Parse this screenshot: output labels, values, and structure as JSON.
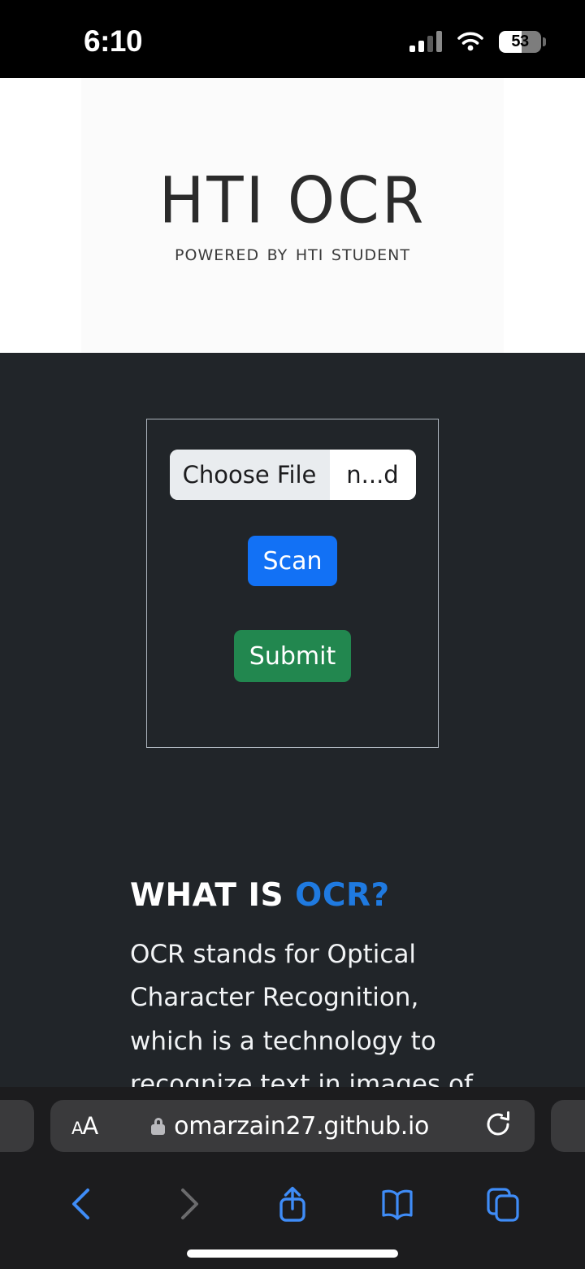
{
  "status_bar": {
    "time": "6:10",
    "signal_icon": "cellular-signal-icon",
    "wifi_icon": "wifi-icon",
    "battery_percent": "53",
    "battery_level": 53
  },
  "site_header": {
    "logo_title": "HTI OCR",
    "logo_subtitle": "Powered by HTI Student"
  },
  "upload_card": {
    "file_input": {
      "button_label": "Choose File",
      "file_name": "n...d"
    },
    "scan_label": "Scan",
    "submit_label": "Submit"
  },
  "about": {
    "heading_prefix": "WHAT IS ",
    "heading_accent": "OCR?",
    "body": "OCR stands for Optical Character Recognition, which is a technology to recognize text in images of scanned"
  },
  "browser": {
    "text_size_small": "A",
    "text_size_big": "A",
    "lock_icon": "lock-icon",
    "url": "omarzain27.github.io",
    "reload_icon": "reload-icon",
    "back_icon": "chevron-left-icon",
    "forward_icon": "chevron-right-icon",
    "share_icon": "share-icon",
    "bookmarks_icon": "book-icon",
    "tabs_icon": "tabs-icon"
  },
  "colors": {
    "page_background": "#212529",
    "header_background": "#ffffff",
    "scan_blue": "#1271f5",
    "submit_green": "#22874f",
    "accent_blue": "#1f7ae0",
    "safari_chrome": "#1c1c1e",
    "safari_control": "#3a3a3c",
    "safari_tint": "#3f8cf7"
  }
}
